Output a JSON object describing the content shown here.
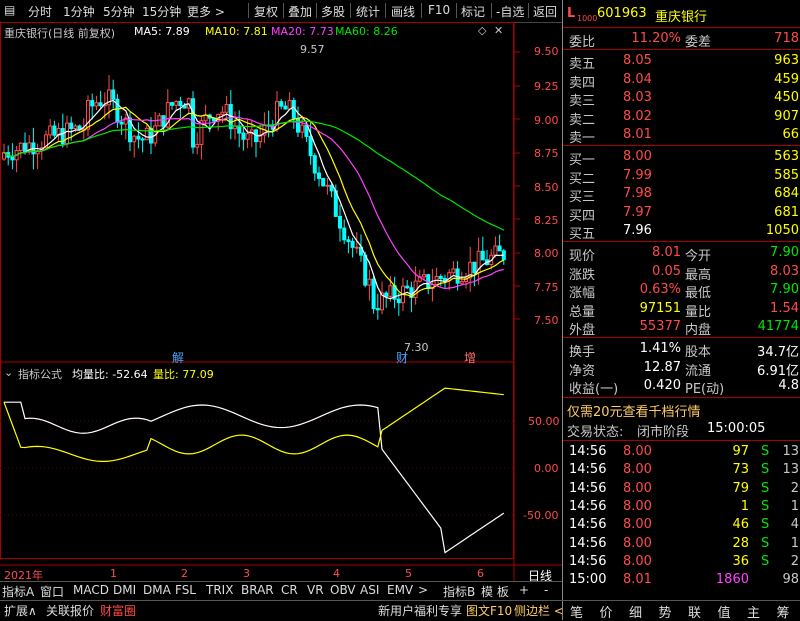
{
  "toolbar": {
    "left": [
      "分时",
      "1分钟",
      "5分钟",
      "15分钟",
      "更多 >"
    ],
    "right": [
      "复权",
      "叠加",
      "多股",
      "统计",
      "画线",
      "F10",
      "标记",
      "-自选",
      "返回"
    ]
  },
  "main_chart": {
    "title": "重庆银行(日线 前复权)",
    "ma": [
      {
        "label": "MA5: 7.89",
        "color": "#ffffff"
      },
      {
        "label": "MA10: 7.81",
        "color": "#ffff00"
      },
      {
        "label": "MA20: 7.73",
        "color": "#ff40ff"
      },
      {
        "label": "MA60: 8.26",
        "color": "#00e600"
      }
    ],
    "high_label": "9.57",
    "low_label": "7.30",
    "markers": [
      "解",
      "财",
      "增"
    ],
    "y_ticks": [
      "9.50",
      "9.25",
      "9.00",
      "8.75",
      "8.50",
      "8.25",
      "8.00",
      "7.75",
      "7.50"
    ]
  },
  "sub_chart": {
    "title": "指标公式",
    "label1": "均量比: -52.64",
    "label2": "量比: 77.09",
    "y_ticks": [
      "50.00",
      "0.00",
      "-50.00"
    ]
  },
  "x_axis": {
    "labels": [
      "2021年",
      "1",
      "2",
      "3",
      "4",
      "5",
      "6"
    ],
    "right": "日线"
  },
  "tabs_row1": [
    "指标A",
    "窗口",
    "MACD",
    "DMI",
    "DMA",
    "FSL",
    "TRIX",
    "BRAR",
    "CR",
    "VR",
    "OBV",
    "ASI",
    "EMV",
    ">",
    "指标B",
    "模 板",
    "+",
    "-"
  ],
  "tabs_row2": [
    "扩展∧",
    "关联报价",
    "财富圈"
  ],
  "tabs_row2_right": [
    "新用户福利专享",
    "图文F10",
    "侧边栏 <"
  ],
  "panel": {
    "code": "601963",
    "name": "重庆银行",
    "weibi_label": "委比",
    "weibi": "11.20%",
    "weicha_label": "委差",
    "weicha": "718",
    "asks": [
      {
        "label": "卖五",
        "price": "8.05",
        "vol": "963"
      },
      {
        "label": "卖四",
        "price": "8.04",
        "vol": "459"
      },
      {
        "label": "卖三",
        "price": "8.03",
        "vol": "450"
      },
      {
        "label": "卖二",
        "price": "8.02",
        "vol": "907"
      },
      {
        "label": "卖一",
        "price": "8.01",
        "vol": "66"
      }
    ],
    "bids": [
      {
        "label": "买一",
        "price": "8.00",
        "vol": "563"
      },
      {
        "label": "买二",
        "price": "7.99",
        "vol": "585"
      },
      {
        "label": "买三",
        "price": "7.98",
        "vol": "684"
      },
      {
        "label": "买四",
        "price": "7.97",
        "vol": "681"
      },
      {
        "label": "买五",
        "price": "7.96",
        "vol": "1050"
      }
    ],
    "stats": [
      {
        "l1": "现价",
        "v1": "8.01",
        "l2": "今开",
        "v2": "7.90"
      },
      {
        "l1": "涨跌",
        "v1": "0.05",
        "l2": "最高",
        "v2": "8.03"
      },
      {
        "l1": "涨幅",
        "v1": "0.63%",
        "l2": "最低",
        "v2": "7.90"
      },
      {
        "l1": "总量",
        "v1": "97151",
        "l2": "量比",
        "v2": "1.54"
      },
      {
        "l1": "外盘",
        "v1": "55377",
        "l2": "内盘",
        "v2": "41774"
      }
    ],
    "fin": [
      {
        "l1": "换手",
        "v1": "1.41%",
        "l2": "股本",
        "v2": "34.7亿"
      },
      {
        "l1": "净资",
        "v1": "12.87",
        "l2": "流通",
        "v2": "6.91亿"
      },
      {
        "l1": "收益(一)",
        "v1": "0.420",
        "l2": "PE(动)",
        "v2": "4.8"
      }
    ],
    "promo": "仅需20元查看千档行情",
    "status_label": "交易状态:",
    "status": "闭市阶段",
    "status_time": "15:00:05",
    "trades": [
      {
        "t": "14:56",
        "p": "8.00",
        "v": "97",
        "d": "S",
        "n": "13"
      },
      {
        "t": "14:56",
        "p": "8.00",
        "v": "73",
        "d": "S",
        "n": "13"
      },
      {
        "t": "14:56",
        "p": "8.00",
        "v": "79",
        "d": "S",
        "n": "2"
      },
      {
        "t": "14:56",
        "p": "8.00",
        "v": "1",
        "d": "S",
        "n": "1"
      },
      {
        "t": "14:56",
        "p": "8.00",
        "v": "46",
        "d": "S",
        "n": "4"
      },
      {
        "t": "14:56",
        "p": "8.00",
        "v": "28",
        "d": "S",
        "n": "1"
      },
      {
        "t": "14:56",
        "p": "8.00",
        "v": "36",
        "d": "S",
        "n": "2"
      },
      {
        "t": "15:00",
        "p": "8.01",
        "v": "1860",
        "d": "",
        "n": "98"
      }
    ],
    "bottom_tabs": [
      "笔",
      "价",
      "细",
      "势",
      "联",
      "值",
      "主",
      "筹"
    ]
  },
  "colors": {
    "up": "#ff4b4b",
    "down": "#00ffff",
    "ma5": "#ffffff",
    "ma10": "#ffff00",
    "ma20": "#ff40ff",
    "ma60": "#00e600"
  }
}
